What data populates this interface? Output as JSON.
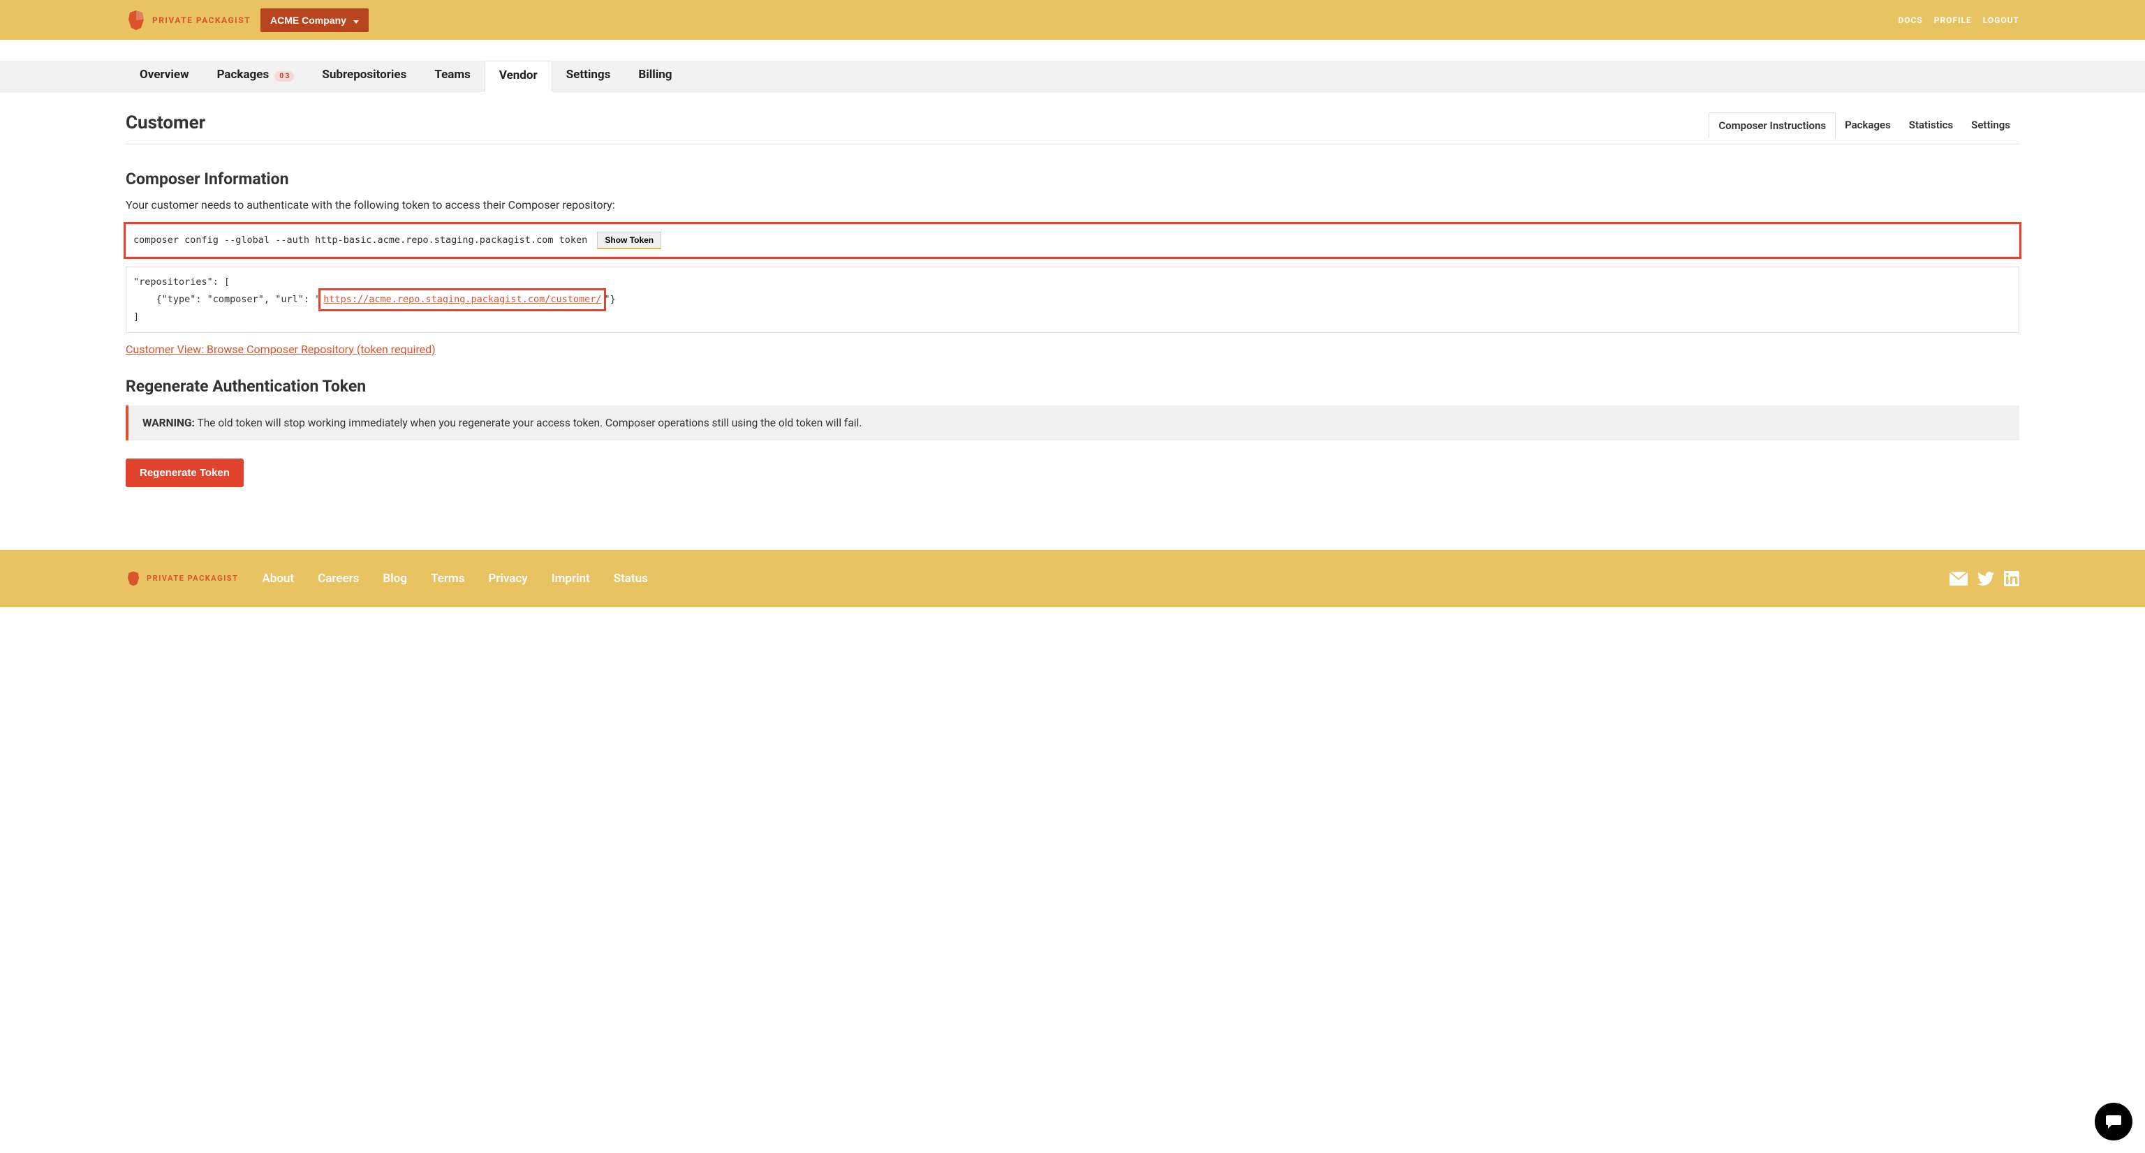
{
  "header": {
    "brand": "PRIVATE PACKAGIST",
    "company_button": "ACME Company",
    "links": {
      "docs": "DOCS",
      "profile": "PROFILE",
      "logout": "LOGOUT"
    }
  },
  "nav": {
    "overview": "Overview",
    "packages": "Packages",
    "packages_badge": "0 3",
    "subrepositories": "Subrepositories",
    "teams": "Teams",
    "vendor": "Vendor",
    "settings": "Settings",
    "billing": "Billing"
  },
  "page": {
    "title": "Customer",
    "subtabs": {
      "composer": "Composer Instructions",
      "packages": "Packages",
      "statistics": "Statistics",
      "settings": "Settings"
    }
  },
  "composer_info": {
    "heading": "Composer Information",
    "desc": "Your customer needs to authenticate with the following token to access their Composer repository:",
    "command": "composer config --global --auth http-basic.acme.repo.staging.packagist.com token",
    "show_token": "Show Token",
    "repo_json_prefix": "\"repositories\": [\n    {\"type\": \"composer\", \"url\": \"",
    "repo_url": "https://acme.repo.staging.packagist.com/customer/",
    "repo_json_suffix": "\"}\n]",
    "customer_view_link": "Customer View: Browse Composer Repository (token required)"
  },
  "regenerate": {
    "heading": "Regenerate Authentication Token",
    "warning_label": "WARNING:",
    "warning_text": " The old token will stop working immediately when you regenerate your access token. Composer operations still using the old token will fail.",
    "button": "Regenerate Token"
  },
  "footer": {
    "brand": "PRIVATE PACKAGIST",
    "links": {
      "about": "About",
      "careers": "Careers",
      "blog": "Blog",
      "terms": "Terms",
      "privacy": "Privacy",
      "imprint": "Imprint",
      "status": "Status"
    }
  }
}
